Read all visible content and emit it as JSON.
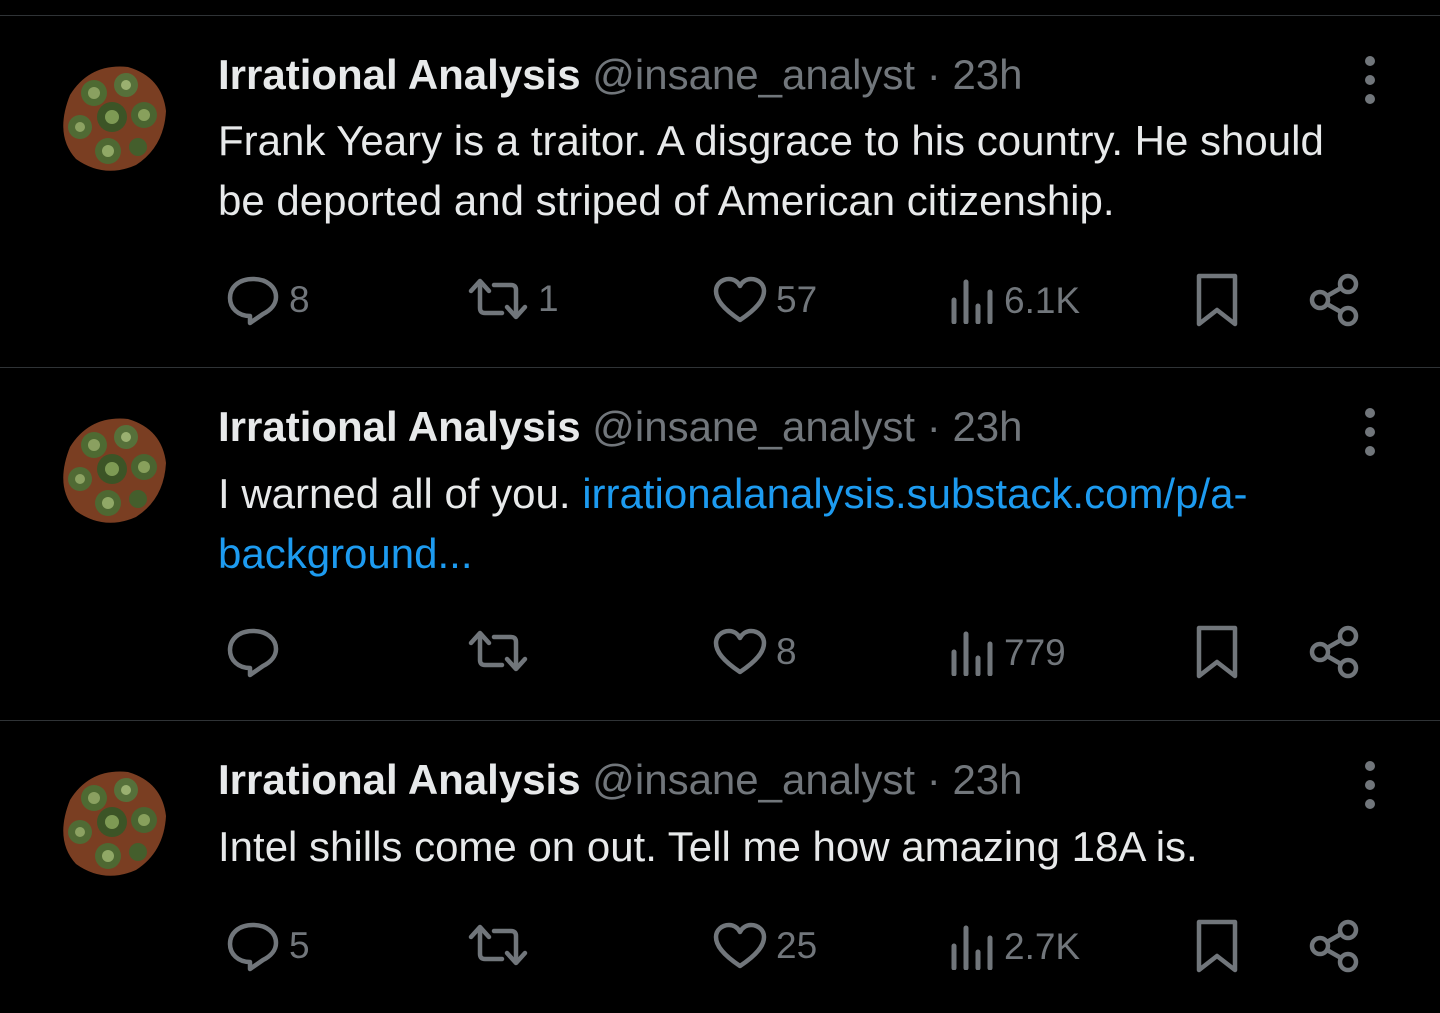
{
  "tweets": [
    {
      "display_name": "Irrational Analysis",
      "handle": "@insane_analyst",
      "separator": "·",
      "time": "23h",
      "text": "Frank Yeary is a traitor. A disgrace to his country. He should be deported and striped of American citizenship.",
      "link_text": "",
      "stats": {
        "replies": "8",
        "reposts": "1",
        "likes": "57",
        "views": "6.1K"
      }
    },
    {
      "display_name": "Irrational Analysis",
      "handle": "@insane_analyst",
      "separator": "·",
      "time": "23h",
      "text": "I warned all of you. ",
      "link_text": "irrationalanalysis.substack.com/p/a-background...",
      "stats": {
        "replies": "",
        "reposts": "",
        "likes": "8",
        "views": "779"
      }
    },
    {
      "display_name": "Irrational Analysis",
      "handle": "@insane_analyst",
      "separator": "·",
      "time": "23h",
      "text": "Intel shills come on out. Tell me how amazing 18A is.",
      "link_text": "",
      "stats": {
        "replies": "5",
        "reposts": "",
        "likes": "25",
        "views": "2.7K"
      }
    }
  ],
  "icons": {
    "reply": "reply-icon",
    "repost": "repost-icon",
    "like": "heart-icon",
    "views": "views-icon",
    "bookmark": "bookmark-icon",
    "share": "share-icon",
    "more": "more-dots-icon"
  },
  "colors": {
    "background": "#000000",
    "text": "#e7e9ea",
    "muted": "#71767b",
    "link": "#1d9bf0",
    "divider": "#2f3336"
  }
}
